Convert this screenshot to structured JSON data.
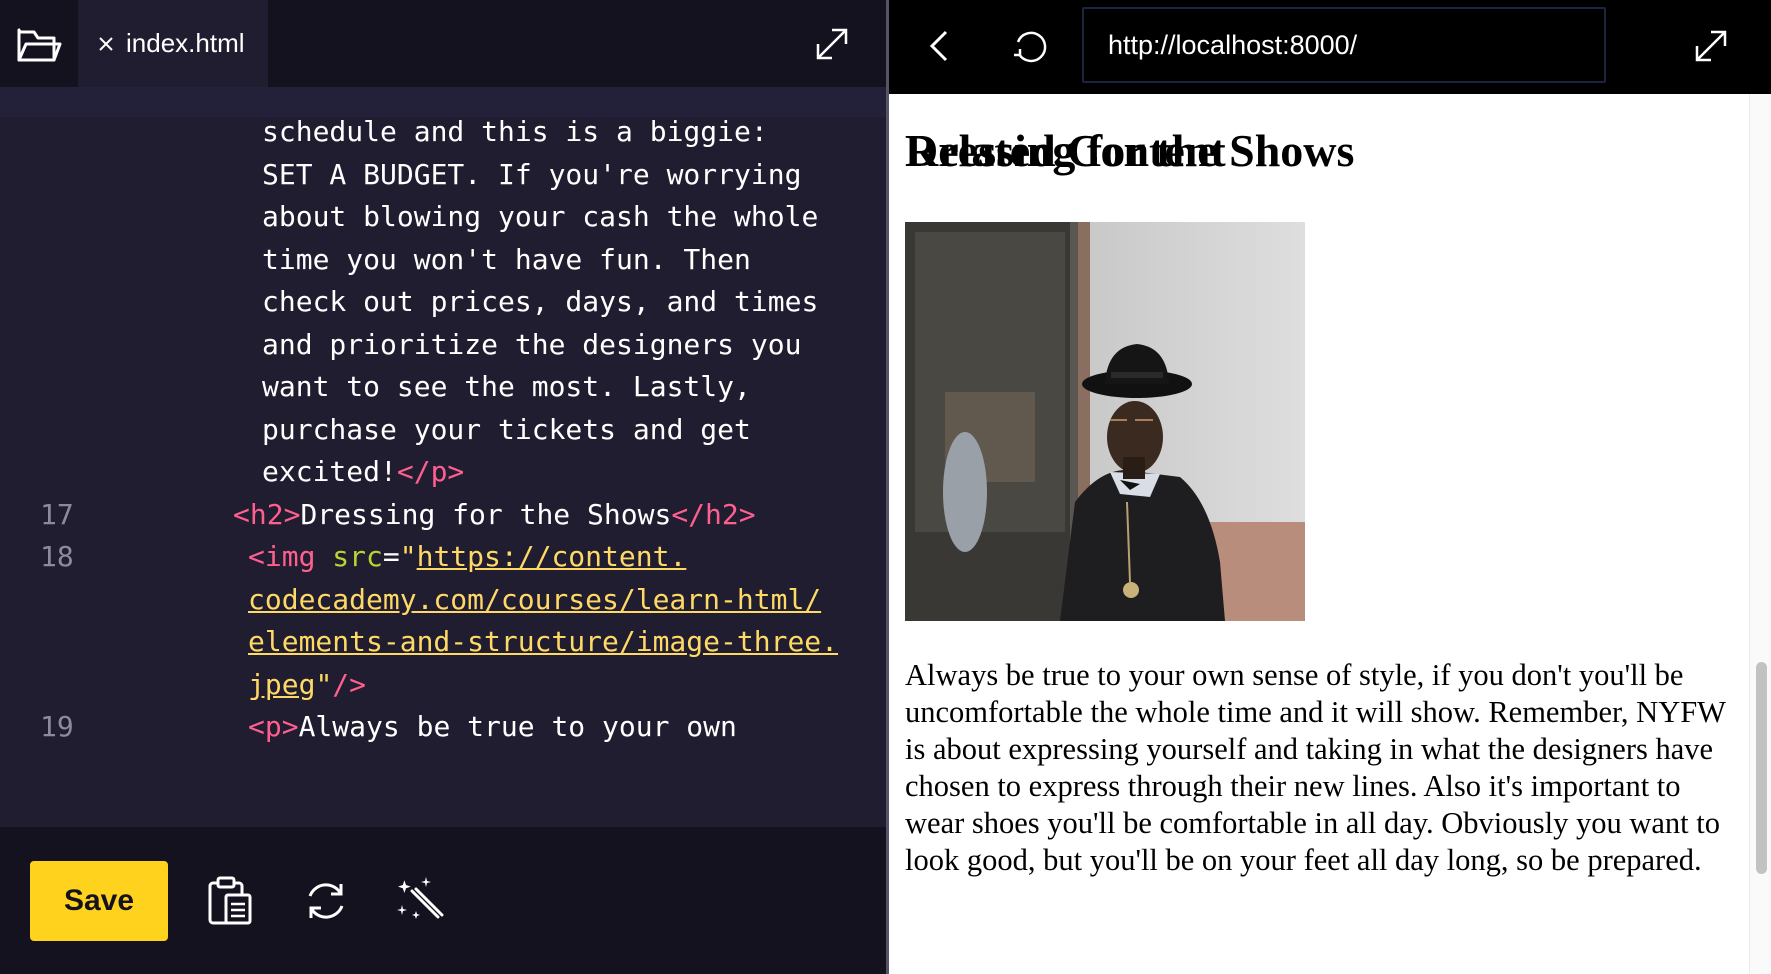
{
  "editor": {
    "tab_name": "index.html",
    "lines": [
      {
        "num": "",
        "indent": 262,
        "tokens": [
          {
            "t": "text",
            "v": "schedule and this is a biggie:"
          }
        ]
      },
      {
        "num": "",
        "indent": 262,
        "tokens": [
          {
            "t": "text",
            "v": "SET A BUDGET. If you're worrying"
          }
        ]
      },
      {
        "num": "",
        "indent": 262,
        "tokens": [
          {
            "t": "text",
            "v": "about blowing your cash the whole"
          }
        ]
      },
      {
        "num": "",
        "indent": 262,
        "tokens": [
          {
            "t": "text",
            "v": "time you won't have fun. Then"
          }
        ]
      },
      {
        "num": "",
        "indent": 262,
        "tokens": [
          {
            "t": "text",
            "v": "check out prices, days, and times"
          }
        ]
      },
      {
        "num": "",
        "indent": 262,
        "tokens": [
          {
            "t": "text",
            "v": "and prioritize the designers you"
          }
        ]
      },
      {
        "num": "",
        "indent": 262,
        "tokens": [
          {
            "t": "text",
            "v": "want to see the most. Lastly,"
          }
        ]
      },
      {
        "num": "",
        "indent": 262,
        "tokens": [
          {
            "t": "text",
            "v": "purchase your tickets and get"
          }
        ]
      },
      {
        "num": "",
        "indent": 262,
        "tokens": [
          {
            "t": "text",
            "v": "excited!"
          },
          {
            "t": "tag",
            "v": "</p>"
          }
        ]
      },
      {
        "num": "17",
        "indent": 233,
        "tokens": [
          {
            "t": "tag",
            "v": "<h2>"
          },
          {
            "t": "text",
            "v": "Dressing for the Shows"
          },
          {
            "t": "tag",
            "v": "</h2>"
          }
        ]
      },
      {
        "num": "18",
        "indent": 248,
        "tokens": [
          {
            "t": "tag",
            "v": "<img "
          },
          {
            "t": "attr",
            "v": "src"
          },
          {
            "t": "text",
            "v": "="
          },
          {
            "t": "str",
            "v": "\""
          },
          {
            "t": "url",
            "v": "https://content."
          }
        ]
      },
      {
        "num": "",
        "indent": 248,
        "tokens": [
          {
            "t": "url",
            "v": "codecademy.com/courses/learn-html/"
          }
        ]
      },
      {
        "num": "",
        "indent": 248,
        "tokens": [
          {
            "t": "url",
            "v": "elements-and-structure/image-three."
          }
        ]
      },
      {
        "num": "",
        "indent": 248,
        "tokens": [
          {
            "t": "url",
            "v": "jpeg"
          },
          {
            "t": "str",
            "v": "\""
          },
          {
            "t": "tag",
            "v": "/>"
          }
        ]
      },
      {
        "num": "19",
        "indent": 248,
        "tokens": [
          {
            "t": "tag",
            "v": "<p>"
          },
          {
            "t": "text",
            "v": "Always be true to your own"
          }
        ]
      }
    ],
    "save_label": "Save"
  },
  "browser": {
    "url": "http://localhost:8000/",
    "heading": "Dressing for the Shows",
    "paragraph": "Always be true to your own sense of style, if you don't you'll be uncomfortable the whole time and it will show. Remember, NYFW is about expressing yourself and taking in what the designers have chosen to express through their new lines. Also it's important to wear shoes you'll be comfortable in all day. Obviously you want to look good, but you'll be on your feet all day long, so be prepared.",
    "next_heading": "Related Content"
  },
  "icons": {
    "folder": "folder-open-icon",
    "close": "close-icon",
    "expand": "expand-icon",
    "clipboard": "clipboard-icon",
    "reset": "refresh-icon",
    "magic": "magic-wand-icon",
    "back": "chevron-left-icon",
    "reload": "reload-icon"
  },
  "colors": {
    "editor_bg": "#1f1d2f",
    "editor_bar": "#14121f",
    "tag": "#ff5f8f",
    "attr": "#b8d433",
    "string": "#ffd966",
    "save_button": "#ffd21e"
  }
}
